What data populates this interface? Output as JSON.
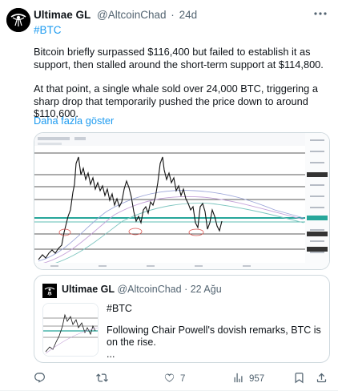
{
  "author": {
    "name": "Ultimae GL",
    "handle": "@AltcoinChad",
    "separator": "·",
    "time": "24d"
  },
  "tweet": {
    "hashtag": "#BTC",
    "paragraph1": "Bitcoin briefly surpassed $116,400 but failed to establish it as support, then stalled around the short-term support at $114,800.",
    "paragraph2": "At that point, a single whale sold over 24,000 BTC, triggering a sharp drop that temporarily pushed the price down to around $110,600.",
    "show_more": "Daha fazla göster"
  },
  "quote": {
    "name": "Ultimae GL",
    "handle": "@AltcoinChad",
    "separator": "·",
    "time": "22 Ağu",
    "hashtag": "#BTC",
    "text": "Following Chair Powell's dovish remarks, BTC is on the rise.",
    "ellipsis": "..."
  },
  "actions": {
    "reply_count": "",
    "retweet_count": "",
    "like_count": "7",
    "views_count": "957"
  },
  "colors": {
    "link": "#1d9bf0",
    "secondary_text": "#536471",
    "border": "#cfd9de"
  },
  "icons": [
    "more-icon",
    "reply-icon",
    "retweet-icon",
    "like-icon",
    "views-icon",
    "bookmark-icon",
    "share-icon"
  ]
}
